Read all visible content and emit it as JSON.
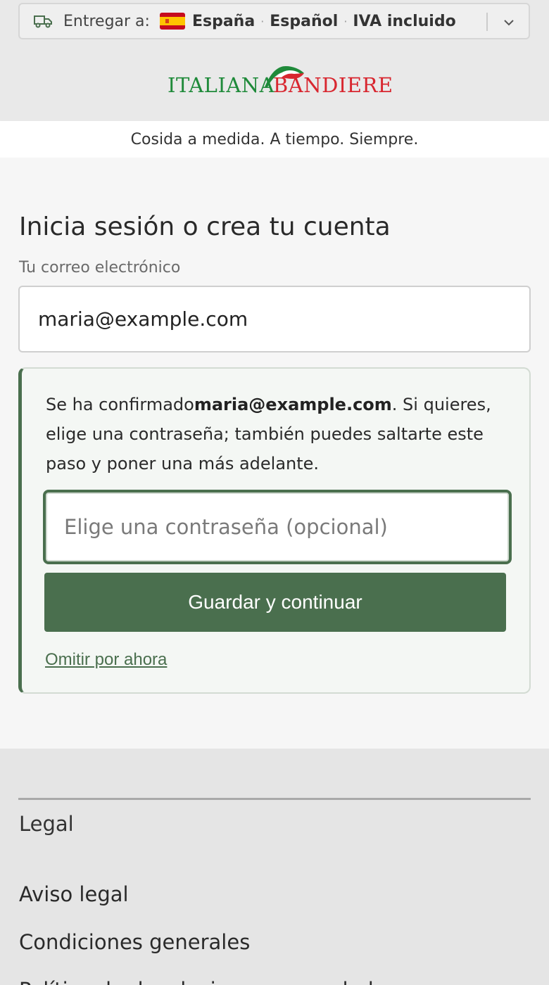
{
  "delivery_bar": {
    "label": "Entregar a:",
    "country": "España",
    "language": "Español",
    "tax": "IVA incluido",
    "separator": "·"
  },
  "brand": {
    "name_left": "ITALIANA",
    "name_right": "BANDIERE",
    "tagline": "Cosida a medida. A tiempo. Siempre."
  },
  "login": {
    "title": "Inicia sesión o crea tu cuenta",
    "email_label": "Tu correo electrónico",
    "email_value": "maria@example.com"
  },
  "confirm_card": {
    "text_before": "Se ha confirmado",
    "email": "maria@example.com",
    "text_after": ". Si quieres, elige una contraseña; también puedes saltarte este paso y poner una más adelante.",
    "password_placeholder": "Elige una contraseña (opcional)",
    "save_button": "Guardar y continuar",
    "skip_link": "Omitir por ahora"
  },
  "footer": {
    "section_title": "Legal",
    "links": [
      "Aviso legal",
      "Condiciones generales",
      "Política de devoluciones y reembolsos"
    ]
  },
  "colors": {
    "accent_green": "#4a6f4e",
    "brand_green": "#1f8a3a",
    "brand_red": "#d8262f"
  },
  "icons": {
    "delivery": "truck-icon",
    "country_flag": "spain-flag-icon",
    "expand": "chevron-down-icon"
  }
}
